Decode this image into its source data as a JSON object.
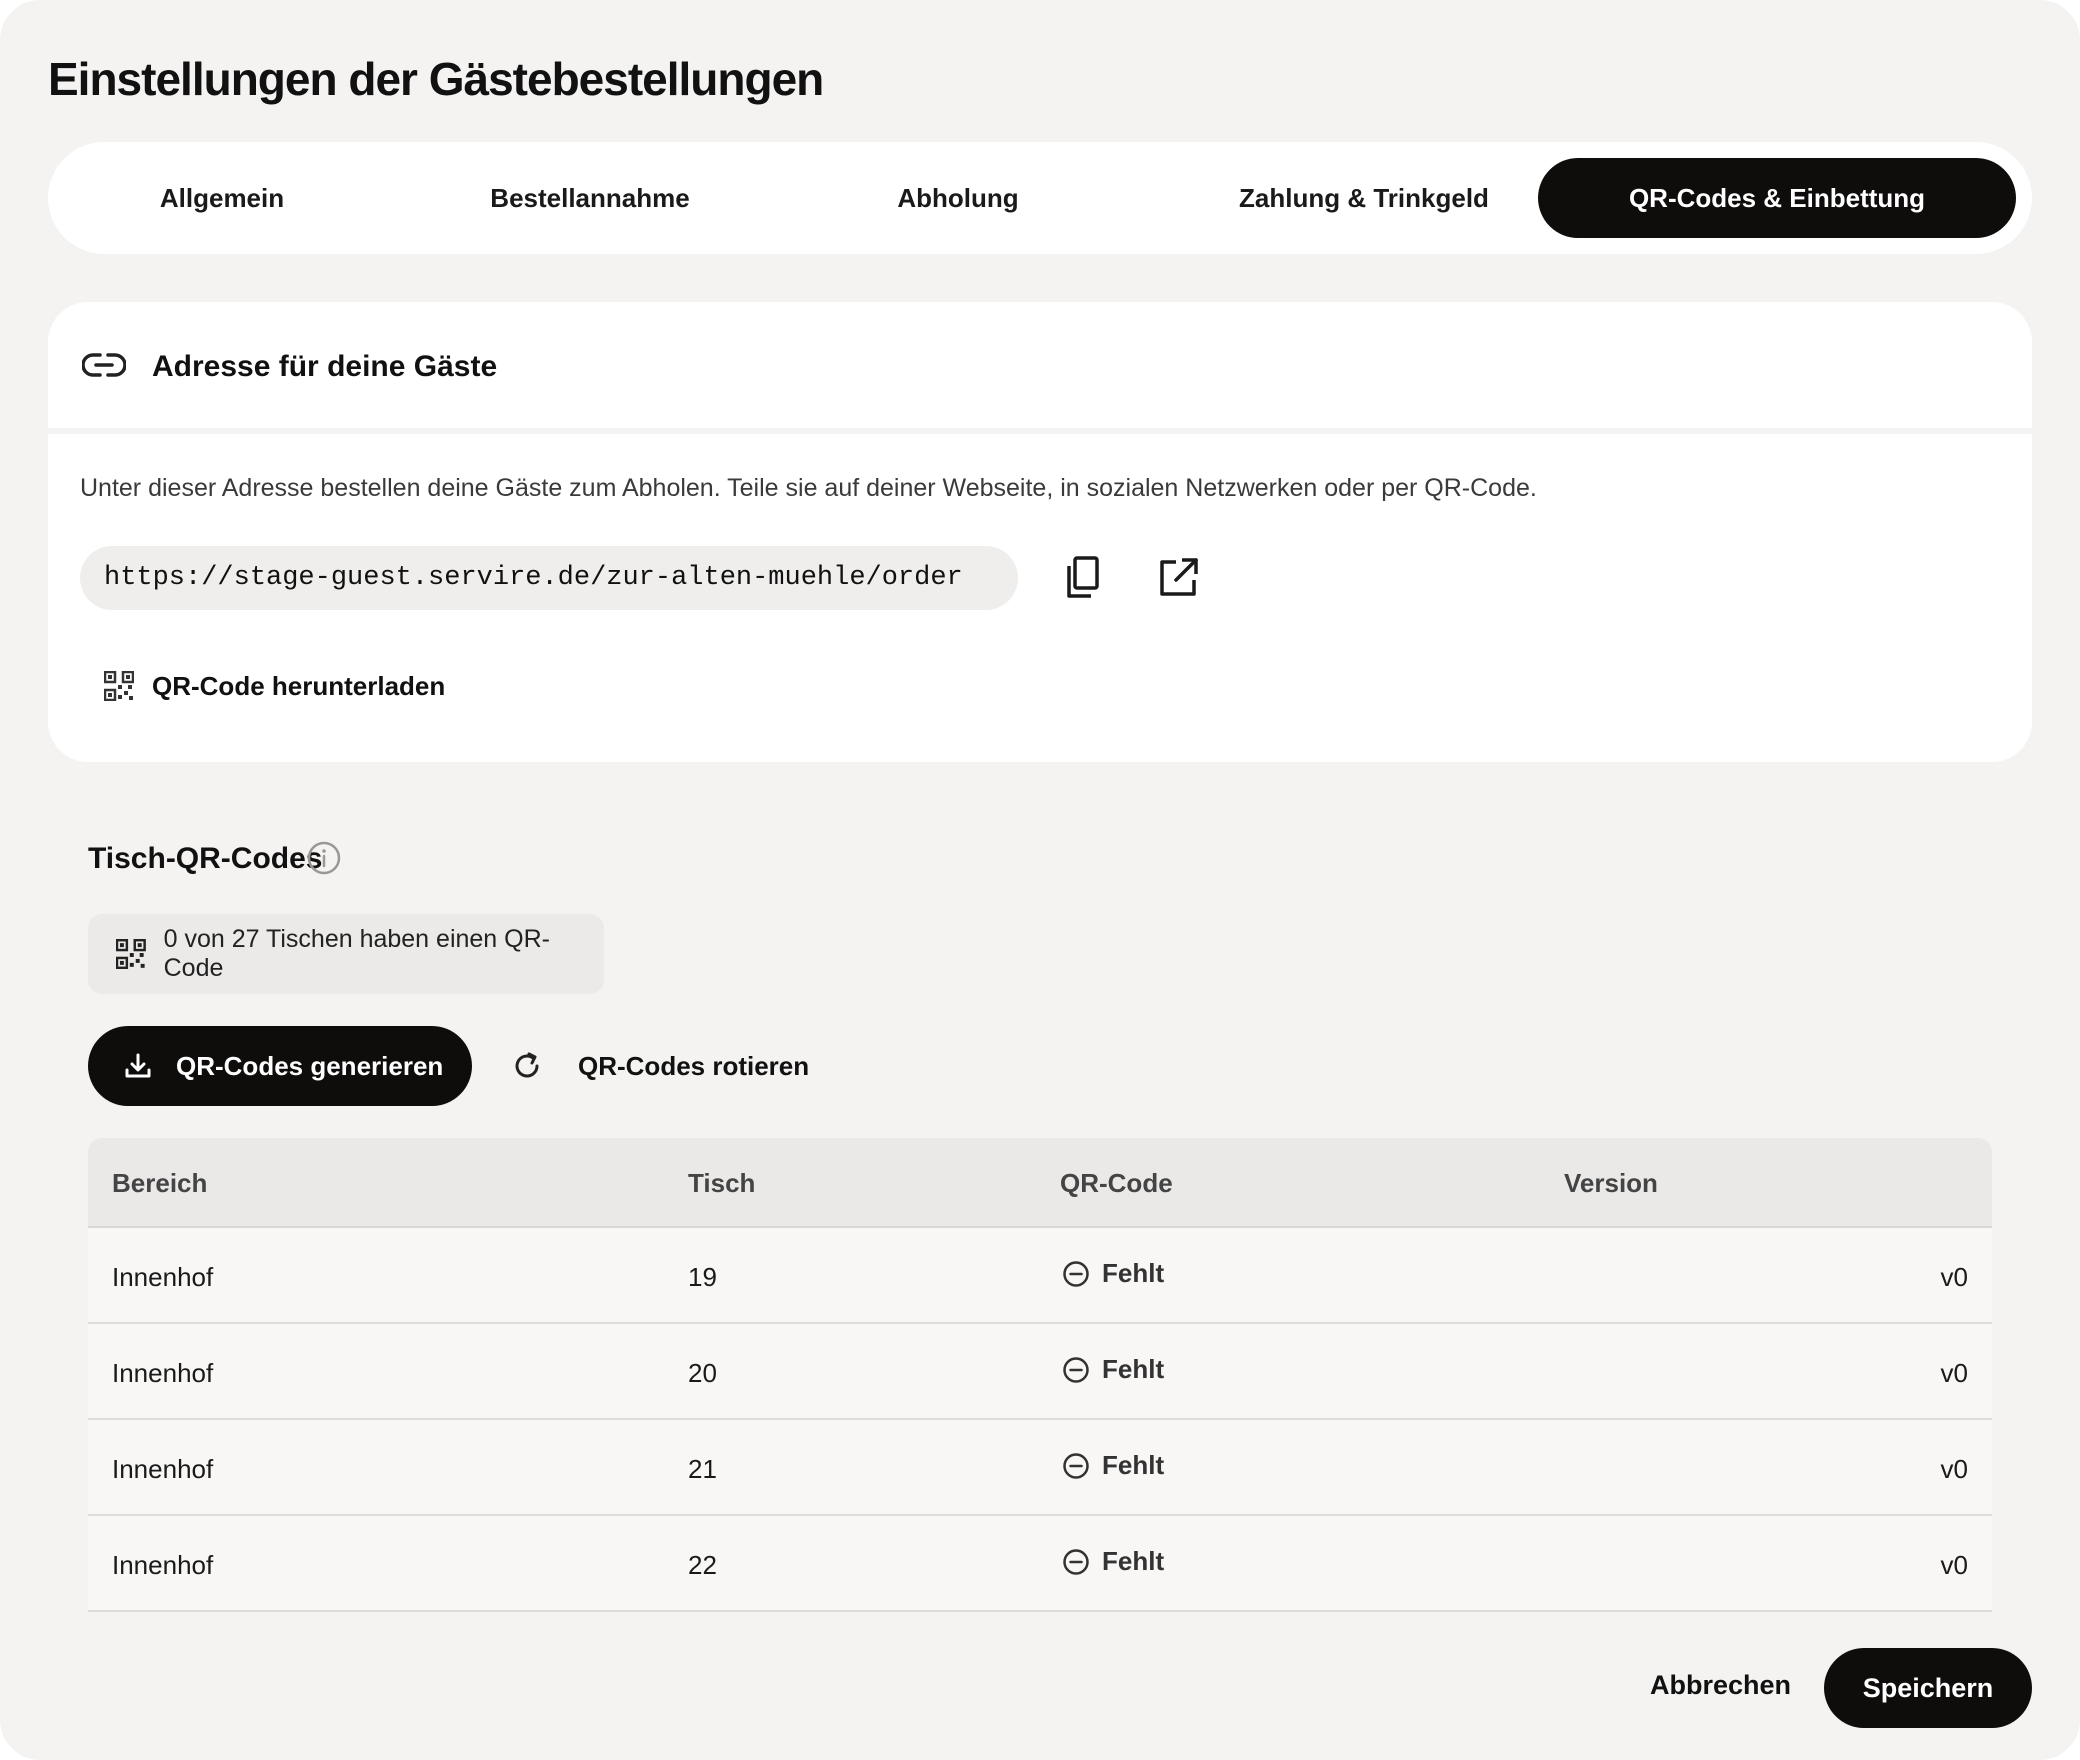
{
  "modal": {
    "title": "Einstellungen der Gästebestellungen"
  },
  "tabs": [
    {
      "label": "Allgemein",
      "active": false
    },
    {
      "label": "Bestellannahme",
      "active": false
    },
    {
      "label": "Abholung",
      "active": false
    },
    {
      "label": "Zahlung & Trinkgeld",
      "active": false
    },
    {
      "label": "QR-Codes & Einbettung",
      "active": true
    }
  ],
  "address": {
    "icon": "link-icon",
    "title": "Adresse für deine Gäste",
    "description": "Unter dieser Adresse bestellen deine Gäste zum Abholen. Teile sie auf deiner Webseite, in sozialen Netzwerken oder per QR-Code.",
    "url": "https://stage-guest.servire.de/zur-alten-muehle/order",
    "copy_icon": "copy-icon",
    "open_icon": "external-link-icon",
    "download_label": "QR-Code herunterladen",
    "download_icon": "qr-code-icon"
  },
  "table_qr": {
    "title": "Tisch-QR-Codes",
    "info_icon": "info-icon",
    "status_text": "0 von 27 Tischen haben einen QR-Code",
    "generate_label": "QR-Codes generieren",
    "rotate_label": "QR-Codes rotieren"
  },
  "table": {
    "headers": {
      "area": "Bereich",
      "table": "Tisch",
      "qr": "QR-Code",
      "version": "Version"
    },
    "rows": [
      {
        "area": "Innenhof",
        "table": "19",
        "qr": "Fehlt",
        "version": "v0"
      },
      {
        "area": "Innenhof",
        "table": "20",
        "qr": "Fehlt",
        "version": "v0"
      },
      {
        "area": "Innenhof",
        "table": "21",
        "qr": "Fehlt",
        "version": "v0"
      },
      {
        "area": "Innenhof",
        "table": "22",
        "qr": "Fehlt",
        "version": "v0"
      }
    ]
  },
  "footer": {
    "cancel_label": "Abbrechen",
    "save_label": "Speichern"
  },
  "colors": {
    "background": "#f4f3f2",
    "surface": "#ffffff",
    "primary": "#0f0d0c",
    "on_primary": "#ffffff"
  }
}
